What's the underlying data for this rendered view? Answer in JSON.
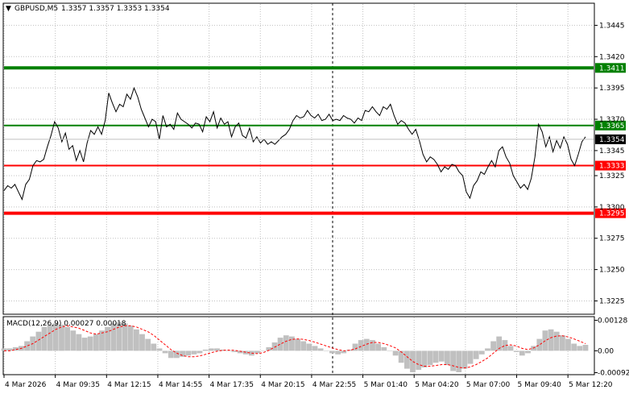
{
  "header": {
    "symbol_label": "GBPUSD,M5",
    "ohlc_label": "1.3357 1.3357 1.3353 1.3354",
    "macd_label": "MACD(12,26,9) 0.00027 0.00018"
  },
  "colors": {
    "price_line": "#000000",
    "grid": "#c0c0c0",
    "green_level": "#008000",
    "red_level": "#ff0000",
    "histogram": "#c0c0c0",
    "signal": "#ff0000"
  },
  "chart_data": [
    {
      "type": "line",
      "title": "GBPUSD,M5",
      "ylim": [
        1.3215,
        1.3462
      ],
      "y_ticks": [
        1.3445,
        1.342,
        1.3395,
        1.337,
        1.3345,
        1.3325,
        1.33,
        1.3275,
        1.325,
        1.3225
      ],
      "y_tick_labels": [
        "1.3445",
        "1.3420",
        "1.3395",
        "1.3370",
        "1.3345",
        "1.3325",
        "1.3300",
        "1.3275",
        "1.3250",
        "1.3225"
      ],
      "current_price": {
        "value": 1.3354,
        "label": "1.3354"
      },
      "levels": [
        {
          "value": 1.3411,
          "label": "1.3411",
          "color": "#008000",
          "weight": "thick"
        },
        {
          "value": 1.3365,
          "label": "1.3365",
          "color": "#008000",
          "weight": "thin"
        },
        {
          "value": 1.3333,
          "label": "1.3333",
          "color": "#ff0000",
          "weight": "thin"
        },
        {
          "value": 1.3295,
          "label": "1.3295",
          "color": "#ff0000",
          "weight": "thick"
        }
      ],
      "x_tick_labels": [
        "4 Mar 2026",
        "4 Mar 09:35",
        "4 Mar 12:15",
        "4 Mar 14:55",
        "4 Mar 17:35",
        "4 Mar 20:15",
        "4 Mar 22:55",
        "5 Mar 01:40",
        "5 Mar 04:20",
        "5 Mar 07:00",
        "5 Mar 09:40",
        "5 Mar 12:20"
      ],
      "series": [
        {
          "values": [
            1.3313,
            1.3317,
            1.3315,
            1.3318,
            1.3312,
            1.3306,
            1.3318,
            1.3322,
            1.3333,
            1.3337,
            1.3336,
            1.3338,
            1.3348,
            1.3357,
            1.3368,
            1.3363,
            1.3352,
            1.3359,
            1.3346,
            1.3349,
            1.3337,
            1.3345,
            1.3336,
            1.3351,
            1.3361,
            1.3358,
            1.3364,
            1.3358,
            1.3369,
            1.3391,
            1.3383,
            1.3376,
            1.3382,
            1.338,
            1.339,
            1.3386,
            1.3395,
            1.3388,
            1.3378,
            1.3371,
            1.3364,
            1.337,
            1.3368,
            1.3354,
            1.3373,
            1.3364,
            1.3366,
            1.3362,
            1.3375,
            1.337,
            1.3368,
            1.3366,
            1.3363,
            1.3367,
            1.3366,
            1.336,
            1.3372,
            1.3368,
            1.3376,
            1.3363,
            1.3371,
            1.3366,
            1.3368,
            1.3356,
            1.3364,
            1.3367,
            1.3357,
            1.3355,
            1.3363,
            1.3352,
            1.3356,
            1.3351,
            1.3354,
            1.335,
            1.3352,
            1.335,
            1.3353,
            1.3356,
            1.3358,
            1.3362,
            1.3369,
            1.3373,
            1.3371,
            1.3372,
            1.3377,
            1.3373,
            1.3371,
            1.3374,
            1.3369,
            1.337,
            1.3374,
            1.3369,
            1.337,
            1.3369,
            1.3373,
            1.3371,
            1.337,
            1.3367,
            1.3371,
            1.3369,
            1.3377,
            1.3376,
            1.338,
            1.3376,
            1.3373,
            1.338,
            1.3378,
            1.3382,
            1.3373,
            1.3366,
            1.3369,
            1.3367,
            1.3362,
            1.3358,
            1.3362,
            1.3353,
            1.3342,
            1.3336,
            1.334,
            1.3338,
            1.3334,
            1.3328,
            1.3332,
            1.333,
            1.3334,
            1.3333,
            1.3328,
            1.3325,
            1.3312,
            1.3307,
            1.3317,
            1.3321,
            1.3328,
            1.3326,
            1.3332,
            1.3337,
            1.3332,
            1.3345,
            1.3348,
            1.334,
            1.3335,
            1.3325,
            1.332,
            1.3315,
            1.3318,
            1.3314,
            1.3323,
            1.334,
            1.3366,
            1.336,
            1.3348,
            1.3356,
            1.3344,
            1.3353,
            1.3347,
            1.3356,
            1.335,
            1.3338,
            1.3333,
            1.3342,
            1.3352,
            1.3356
          ]
        }
      ]
    },
    {
      "type": "bar",
      "title": "MACD(12,26,9) 0.00027 0.00018",
      "ylim": [
        -0.00097,
        0.0014
      ],
      "y_tick_labels": [
        "0.00128",
        "0.00",
        "-0.00092"
      ],
      "y_ticks": [
        0.00128,
        0.0,
        -0.00092
      ],
      "series": [
        {
          "name": "MACD",
          "values": [
            0.0001,
            0.0001,
            0.00015,
            0.0002,
            0.0004,
            0.0006,
            0.0008,
            0.001,
            0.0011,
            0.00115,
            0.0011,
            0.001,
            0.00085,
            0.0007,
            0.00055,
            0.0006,
            0.0007,
            0.00085,
            0.001,
            0.00115,
            0.0012,
            0.00115,
            0.00105,
            0.0009,
            0.0007,
            0.0005,
            0.0003,
            0.0001,
            -0.0001,
            -0.0003,
            -0.0003,
            -0.00025,
            -0.0002,
            -0.00015,
            -0.0001,
            5e-05,
            0.0001,
            0.0001,
            5e-05,
            0.0,
            -5e-05,
            -0.0001,
            -0.00015,
            -0.0002,
            -0.0001,
            0.0,
            0.00015,
            0.00035,
            0.00055,
            0.00065,
            0.0006,
            0.0005,
            0.0004,
            0.0003,
            0.0002,
            0.0001,
            0.0,
            -0.0001,
            -0.00015,
            -0.0001,
            5e-05,
            0.0003,
            0.00045,
            0.0005,
            0.00045,
            0.0003,
            0.00015,
            0.0,
            -0.0002,
            -0.0005,
            -0.00075,
            -0.0009,
            -0.0008,
            -0.0007,
            -0.0006,
            -0.0005,
            -0.00045,
            -0.0006,
            -0.00085,
            -0.0009,
            -0.00075,
            -0.00055,
            -0.00035,
            -0.00015,
            0.0001,
            0.0004,
            0.0006,
            0.00045,
            0.0002,
            -5e-05,
            -0.0002,
            -0.0001,
            0.0002,
            0.0005,
            0.00085,
            0.0009,
            0.0008,
            0.00065,
            0.0005,
            0.0003,
            0.0002,
            0.00025
          ]
        },
        {
          "name": "Signal",
          "values": [
            0.0,
            0.0,
            5e-05,
            0.0001,
            0.0002,
            0.0003,
            0.00045,
            0.0006,
            0.00075,
            0.0009,
            0.001,
            0.00105,
            0.001,
            0.00095,
            0.00085,
            0.00075,
            0.0007,
            0.00075,
            0.0008,
            0.0009,
            0.001,
            0.00105,
            0.00105,
            0.001,
            0.0009,
            0.0008,
            0.00065,
            0.00045,
            0.00025,
            5e-05,
            -0.0001,
            -0.0002,
            -0.00025,
            -0.00025,
            -0.00022,
            -0.00015,
            -8e-05,
            -2e-05,
            2e-05,
            3e-05,
            2e-05,
            -2e-05,
            -6e-05,
            -0.0001,
            -0.00012,
            -8e-05,
            2e-05,
            0.00015,
            0.00028,
            0.0004,
            0.00048,
            0.0005,
            0.00048,
            0.00043,
            0.00036,
            0.00028,
            0.0002,
            0.00012,
            5e-05,
            0.0,
            2e-05,
            8e-05,
            0.00018,
            0.00028,
            0.00035,
            0.00035,
            0.0003,
            0.00022,
            0.00012,
            -5e-05,
            -0.00025,
            -0.00045,
            -0.00058,
            -0.00065,
            -0.00065,
            -0.00062,
            -0.00058,
            -0.00058,
            -0.00063,
            -0.0007,
            -0.00072,
            -0.00068,
            -0.00058,
            -0.00045,
            -0.0003,
            -0.0001,
            0.0001,
            0.00022,
            0.00025,
            0.0002,
            0.0001,
            5e-05,
            0.00012,
            0.00025,
            0.00042,
            0.00055,
            0.00062,
            0.00063,
            0.00058,
            0.0005,
            0.0004,
            0.0003
          ]
        }
      ]
    }
  ]
}
